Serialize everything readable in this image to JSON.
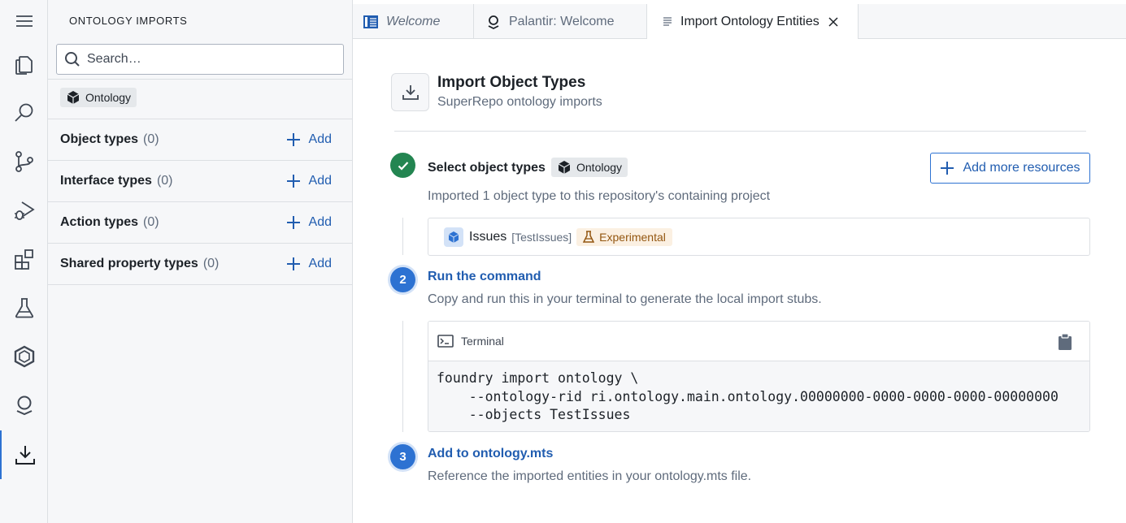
{
  "activity_bar": {
    "items": [
      {
        "icon": "menu-icon"
      },
      {
        "icon": "files-icon"
      },
      {
        "icon": "search-icon"
      },
      {
        "icon": "source-control-icon"
      },
      {
        "icon": "run-debug-icon"
      },
      {
        "icon": "extensions-icon"
      },
      {
        "icon": "flask-icon"
      },
      {
        "icon": "hexagon-icon"
      },
      {
        "icon": "palantir-icon"
      },
      {
        "icon": "import-icon",
        "active": true
      }
    ]
  },
  "sidebar": {
    "title": "ONTOLOGY IMPORTS",
    "search_placeholder": "Search…",
    "filter_tag": "Ontology",
    "sections": [
      {
        "label": "Object types",
        "count": "(0)",
        "add": "Add"
      },
      {
        "label": "Interface types",
        "count": "(0)",
        "add": "Add"
      },
      {
        "label": "Action types",
        "count": "(0)",
        "add": "Add"
      },
      {
        "label": "Shared property types",
        "count": "(0)",
        "add": "Add"
      }
    ]
  },
  "tabs": [
    {
      "label": "Welcome",
      "icon": "book-icon"
    },
    {
      "label": "Palantir: Welcome",
      "icon": "palantir-icon"
    },
    {
      "label": "Import Ontology Entities",
      "icon": "document-icon",
      "active": true
    }
  ],
  "main": {
    "title": "Import Object Types",
    "subtitle": "SuperRepo ontology imports",
    "add_more_label": "Add more resources",
    "steps": [
      {
        "number": "1",
        "status": "done",
        "title": "Select object types",
        "tag": "Ontology",
        "description": "Imported 1 object type to this repository's containing project",
        "resource": {
          "name": "Issues",
          "api_name": "[TestIssues]",
          "badge": "Experimental"
        }
      },
      {
        "number": "2",
        "title": "Run the command",
        "description": "Copy and run this in your terminal to generate the local import stubs.",
        "terminal_label": "Terminal",
        "command": "foundry import ontology \\\n    --ontology-rid ri.ontology.main.ontology.00000000-0000-0000-0000-00000000\n    --objects TestIssues"
      },
      {
        "number": "3",
        "title": "Add to ontology.mts",
        "description": "Reference the imported entities in your ontology.mts file."
      }
    ]
  },
  "colors": {
    "accent": "#2d72d2",
    "link": "#215db0",
    "success": "#238551",
    "warning_bg": "#fbf0e2",
    "warning_text": "#935610"
  }
}
